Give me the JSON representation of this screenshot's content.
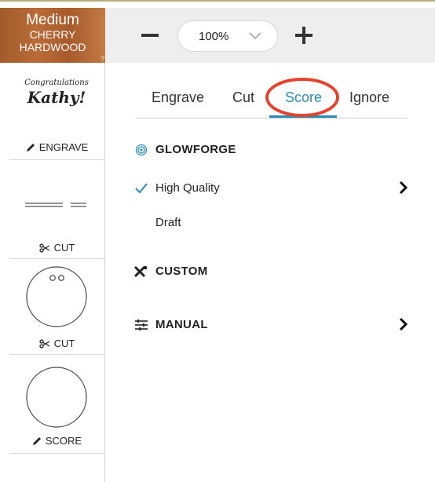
{
  "material": {
    "grade": "Medium",
    "line1": "CHERRY",
    "line2": "HARDWOOD",
    "help": "?"
  },
  "zoom": {
    "value": "100%"
  },
  "steps": [
    {
      "thumb_line1": "Congratulations",
      "thumb_line2": "Kathy!",
      "label": "ENGRAVE"
    },
    {
      "label": "CUT"
    },
    {
      "label": "CUT"
    },
    {
      "label": "SCORE"
    }
  ],
  "tabs": [
    {
      "label": "Engrave"
    },
    {
      "label": "Cut"
    },
    {
      "label": "Score",
      "active": true
    },
    {
      "label": "Ignore"
    }
  ],
  "sections": {
    "glowforge": {
      "title": "GLOWFORGE",
      "options": [
        {
          "label": "High Quality",
          "selected": true
        },
        {
          "label": "Draft"
        }
      ]
    },
    "custom": {
      "title": "CUSTOM"
    },
    "manual": {
      "title": "MANUAL"
    }
  },
  "colors": {
    "accent": "#2a8bb4",
    "annotation": "#e2442f",
    "material": "#b0622f",
    "toolbar": "#eeeeee"
  }
}
